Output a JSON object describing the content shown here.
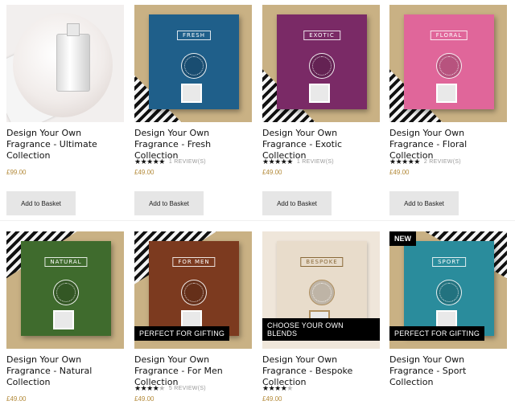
{
  "products": [
    {
      "title": "Design Your Own Fragrance - Ultimate Collection",
      "rating": null,
      "reviews": "",
      "price": "£99.00",
      "button": "Add to Basket",
      "box_label": "",
      "box_color": "#ffffff",
      "badge": "",
      "new": ""
    },
    {
      "title": "Design Your Own Fragrance - Fresh Collection",
      "rating": 5,
      "reviews": "1 REVIEW(S)",
      "price": "£49.00",
      "button": "Add to Basket",
      "box_label": "FRESH",
      "box_color": "#1f5f8a",
      "badge": "",
      "new": ""
    },
    {
      "title": "Design Your Own Fragrance - Exotic Collection",
      "rating": 5,
      "reviews": "1 REVIEW(S)",
      "price": "£49.00",
      "button": "Add to Basket",
      "box_label": "EXOTIC",
      "box_color": "#7a2a66",
      "badge": "",
      "new": ""
    },
    {
      "title": "Design Your Own Fragrance - Floral Collection",
      "rating": 5,
      "reviews": "2 REVIEW(S)",
      "price": "£49.00",
      "button": "Add to Basket",
      "box_label": "FLORAL",
      "box_color": "#e0669a",
      "badge": "",
      "new": ""
    },
    {
      "title": "Design Your Own Fragrance - Natural Collection",
      "rating": null,
      "reviews": "",
      "price": "£49.00",
      "button": "",
      "box_label": "NATURAL",
      "box_color": "#3f6b2d",
      "badge": "",
      "new": ""
    },
    {
      "title": "Design Your Own Fragrance - For Men Collection",
      "rating": 4.5,
      "reviews": "5 REVIEW(S)",
      "price": "£49.00",
      "button": "",
      "box_label": "FOR MEN",
      "box_color": "#7c3a1f",
      "badge": "PERFECT FOR GIFTING",
      "new": ""
    },
    {
      "title": "Design Your Own Fragrance - Bespoke Collection",
      "rating": 4,
      "reviews": "",
      "price": "£49.00",
      "button": "",
      "box_label": "BESPOKE",
      "box_color": "#e8dccb",
      "badge": "CHOOSE YOUR OWN BLENDS",
      "new": ""
    },
    {
      "title": "Design Your Own Fragrance - Sport Collection",
      "rating": null,
      "reviews": "",
      "price": "",
      "button": "",
      "box_label": "SPORT",
      "box_color": "#2a8c9c",
      "badge": "PERFECT FOR GIFTING",
      "new": "NEW"
    }
  ]
}
